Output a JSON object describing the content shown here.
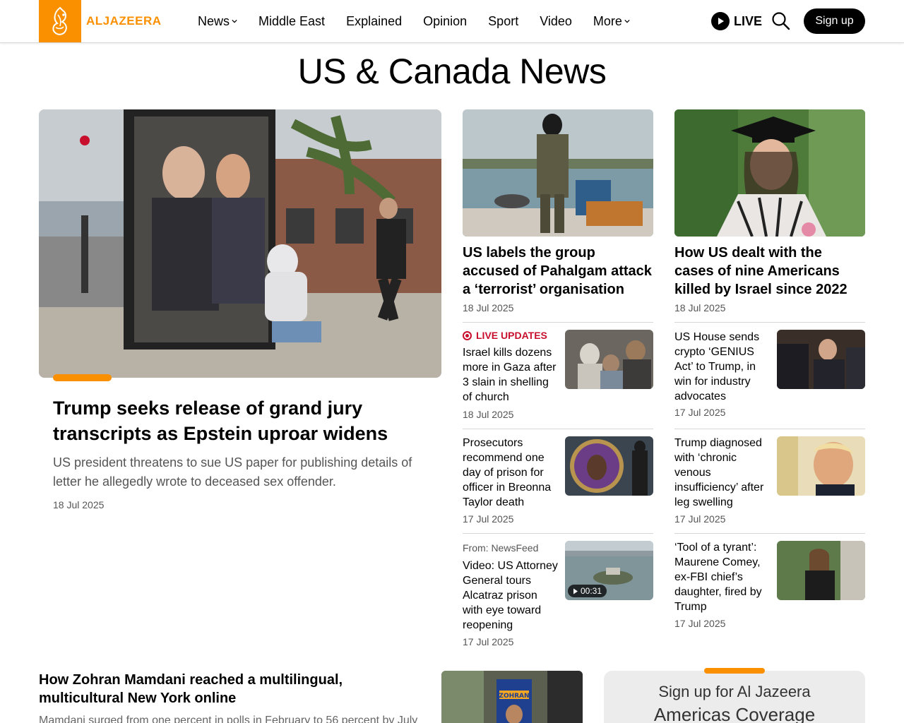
{
  "header": {
    "logo_text": "ALJAZEERA",
    "nav": [
      {
        "label": "News",
        "has_dropdown": true
      },
      {
        "label": "Middle East",
        "has_dropdown": false
      },
      {
        "label": "Explained",
        "has_dropdown": false
      },
      {
        "label": "Opinion",
        "has_dropdown": false
      },
      {
        "label": "Sport",
        "has_dropdown": false
      },
      {
        "label": "Video",
        "has_dropdown": false
      },
      {
        "label": "More",
        "has_dropdown": true
      }
    ],
    "live_label": "LIVE",
    "signup_label": "Sign up",
    "accent_color": "#fa9000"
  },
  "page_title": "US & Canada News",
  "hero": {
    "title": "Trump seeks release of grand jury transcripts as Epstein uproar widens",
    "summary": "US president threatens to sue US paper for publishing details of letter he allegedly wrote to deceased sex offender.",
    "date": "18 Jul 2025"
  },
  "column_top": [
    {
      "title": "US labels the group accused of Pahalgam attack a ‘terrorist’ organisation",
      "date": "18 Jul 2025"
    },
    {
      "title": "How US dealt with the cases of nine Americans killed by Israel since 2022",
      "date": "18 Jul 2025"
    }
  ],
  "small_stories_left": [
    {
      "tag": "LIVE UPDATES",
      "title": "Israel kills dozens more in Gaza after 3 slain in shelling of church",
      "date": "18 Jul 2025"
    },
    {
      "title": "Prosecutors recommend one day of prison for officer in Breonna Taylor death",
      "date": "17 Jul 2025"
    },
    {
      "from": "From: NewsFeed",
      "title": "Video: US Attorney General tours Alcatraz prison with eye toward reopening",
      "date": "17 Jul 2025",
      "duration": "00:31"
    }
  ],
  "small_stories_right": [
    {
      "title": "US House sends crypto ‘GENIUS Act’ to Trump, in win for industry advocates",
      "date": "17 Jul 2025"
    },
    {
      "title": "Trump diagnosed with ‘chronic venous insufficiency’ after leg swelling",
      "date": "17 Jul 2025"
    },
    {
      "title": "‘Tool of a tyrant’: Maurene Comey, ex-FBI chief’s daughter, fired by Trump",
      "date": "17 Jul 2025"
    }
  ],
  "bottom": {
    "title": "How Zohran Mamdani reached a multilingual, multicultural New York online",
    "summary": "Mamdani surged from one percent in polls in February to 56 percent by July",
    "poster_text": "ZOHRAN"
  },
  "newsletter": {
    "line1": "Sign up for Al Jazeera",
    "line2": "Americas Coverage"
  }
}
